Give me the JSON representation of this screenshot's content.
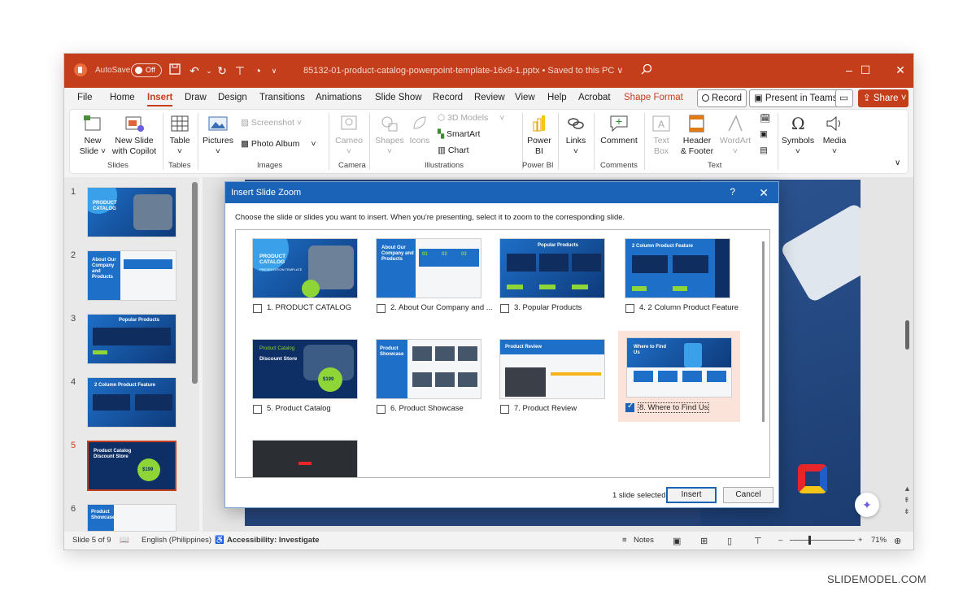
{
  "titlebar": {
    "autosave_label": "AutoSave",
    "autosave_state": "Off",
    "filename": "85132-01-product-catalog-powerpoint-template-16x9-1.pptx  •  Saved to this PC ∨"
  },
  "tabs": [
    "File",
    "Home",
    "Insert",
    "Draw",
    "Design",
    "Transitions",
    "Animations",
    "Slide Show",
    "Record",
    "Review",
    "View",
    "Help",
    "Acrobat",
    "Shape Format"
  ],
  "active_tab": "Insert",
  "top_buttons": {
    "record": "Record",
    "present": "Present in Teams",
    "share": "Share"
  },
  "ribbon": {
    "new_slide": "New\nSlide",
    "new_slide_copilot": "New Slide\nwith Copilot",
    "table": "Table",
    "pictures": "Pictures",
    "screenshot": "Screenshot",
    "photo_album": "Photo Album",
    "cameo": "Cameo",
    "shapes": "Shapes",
    "icons": "Icons",
    "models3d": "3D Models",
    "smartart": "SmartArt",
    "chart": "Chart",
    "power_bi": "Power\nBI",
    "links": "Links",
    "comment": "Comment",
    "text_box": "Text\nBox",
    "header_footer": "Header\n& Footer",
    "wordart": "WordArt",
    "symbols": "Symbols",
    "media": "Media",
    "groups": [
      "Slides",
      "Tables",
      "Images",
      "Camera",
      "Illustrations",
      "Power BI",
      "Comments",
      "Text"
    ]
  },
  "thumbnails": [
    {
      "num": "1",
      "title": "PRODUCT CATALOG"
    },
    {
      "num": "2",
      "title": "About Our Company and Products"
    },
    {
      "num": "3",
      "title": "Popular Products"
    },
    {
      "num": "4",
      "title": "2 Column Product Feature"
    },
    {
      "num": "5",
      "title": "Product Catalog Discount Store",
      "price": "$199"
    },
    {
      "num": "6",
      "title": "Product Showcase"
    }
  ],
  "dialog": {
    "title": "Insert Slide Zoom",
    "help": "?",
    "instruction": "Choose the slide or slides you want to insert. When you're presenting, select it to zoom to the corresponding slide.",
    "slides": [
      {
        "label": "1. PRODUCT CATALOG",
        "checked": false
      },
      {
        "label": "2. About Our Company and ...",
        "checked": false
      },
      {
        "label": "3. Popular Products",
        "checked": false
      },
      {
        "label": "4. 2 Column Product Feature",
        "checked": false
      },
      {
        "label": "5. Product Catalog",
        "checked": false
      },
      {
        "label": "6. Product Showcase",
        "checked": false
      },
      {
        "label": "7. Product Review",
        "checked": false
      },
      {
        "label": "8. Where to  Find Us",
        "checked": true
      }
    ],
    "selection_status": "1 slide selected",
    "insert_label": "Insert",
    "cancel_label": "Cancel"
  },
  "slide_art": {
    "s1_title": "PRODUCT CATALOG",
    "s1_sub": "PRESENTATION TEMPLATE",
    "s2_title": "About Our Company and Products",
    "s2_nums": [
      "01",
      "02",
      "03"
    ],
    "s3_title": "Popular Products",
    "s4_title": "2 Column Product Feature",
    "s5_kicker": "Product Catalog",
    "s5_title": "Discount Store",
    "s5_price": "$199",
    "s6_title": "Product Showcase",
    "s7_title": "Product Review",
    "s8_title": "Where to Find Us"
  },
  "status": {
    "slide_info": "Slide 5 of 9",
    "language": "English (Philippines)",
    "accessibility": "Accessibility: Investigate",
    "notes": "Notes",
    "zoom": "71%"
  },
  "watermark": "SLIDEMODEL.COM",
  "colors": {
    "brand": "#c43e1c",
    "dialog_header": "#1b63b6",
    "slide_blue": "#1e6fc8",
    "accent_green": "#8ed638"
  }
}
